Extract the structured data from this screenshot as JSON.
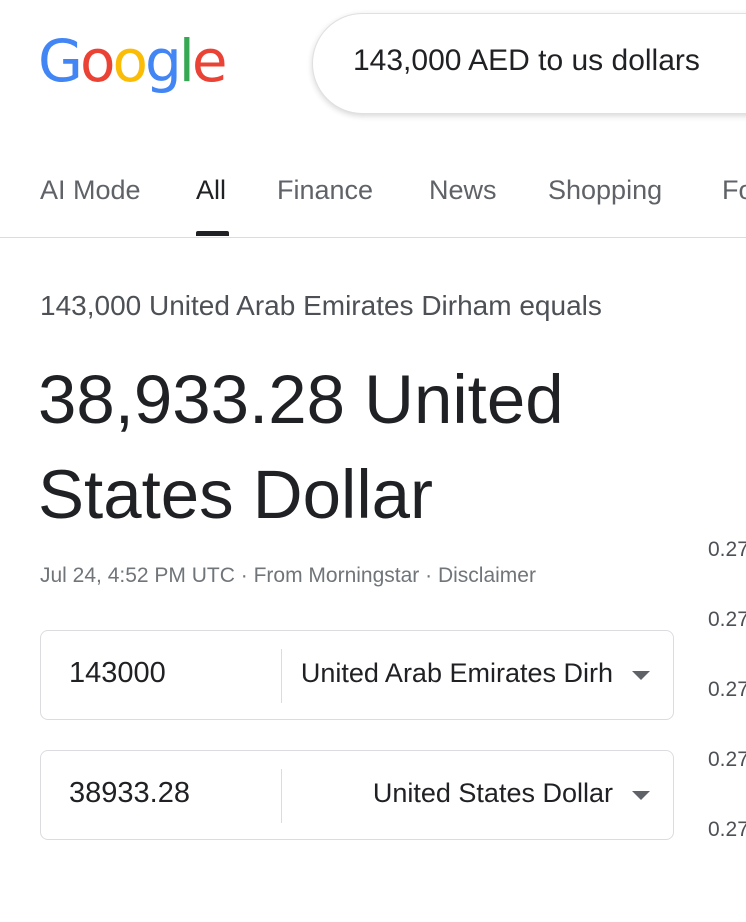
{
  "logo": {
    "letters": [
      {
        "char": "G",
        "color": "#4285F4"
      },
      {
        "char": "o",
        "color": "#EA4335"
      },
      {
        "char": "o",
        "color": "#FBBC05"
      },
      {
        "char": "g",
        "color": "#4285F4"
      },
      {
        "char": "l",
        "color": "#34A853"
      },
      {
        "char": "e",
        "color": "#EA4335"
      }
    ]
  },
  "search": {
    "query": "143,000 AED to us dollars"
  },
  "tabs": [
    {
      "label": "AI Mode",
      "active": false
    },
    {
      "label": "All",
      "active": true
    },
    {
      "label": "Finance",
      "active": false
    },
    {
      "label": "News",
      "active": false
    },
    {
      "label": "Shopping",
      "active": false
    },
    {
      "label": "Fo",
      "active": false
    }
  ],
  "result": {
    "from_text": "143,000 United Arab Emirates Dirham equals",
    "to_text": "38,933.28 United States Dollar",
    "timestamp": "Jul 24, 4:52 PM UTC",
    "source": "From Morningstar",
    "disclaimer": "Disclaimer"
  },
  "converter": {
    "from": {
      "value": "143000",
      "currency": "United Arab Emirates Dirh"
    },
    "to": {
      "value": "38933.28",
      "currency": "United States Dollar"
    }
  },
  "side_rates": [
    "0.27",
    "0.27",
    "0.27",
    "0.27",
    "0.27"
  ],
  "colors": {
    "text_primary": "#202124",
    "text_secondary": "#4d5156",
    "border": "#dadce0"
  }
}
